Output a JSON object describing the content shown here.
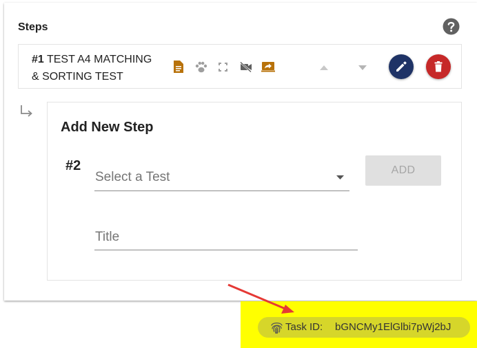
{
  "steps": {
    "heading": "Steps",
    "help_icon": "help-circle-icon",
    "items": [
      {
        "number": "#1",
        "title_line1": "TEST A4 MATCHING",
        "title_line2": "& SORTING TEST",
        "icons": [
          "document-icon",
          "paw-icon",
          "fullscreen-icon",
          "video-off-icon",
          "share-screen-icon"
        ],
        "move_up_icon": "arrow-up-icon",
        "move_down_icon": "arrow-down-icon",
        "edit_icon": "pencil-icon",
        "delete_icon": "trash-icon"
      }
    ]
  },
  "add_step": {
    "title": "Add New Step",
    "next_number": "#2",
    "test_select_label": "Select a Test",
    "title_field_label": "Title",
    "add_button": "ADD"
  },
  "task": {
    "label": "Task ID:",
    "value": "bGNCMy1ElGlbi7pWj2bJ"
  },
  "colors": {
    "orange_icon": "#b8720a",
    "grey_icon": "#9e9e9e",
    "dark_icon": "#5f5f5f",
    "edit_button": "#1f3366",
    "delete_button": "#c62828",
    "highlight": "#ffff00",
    "annotation_arrow": "#e53935"
  }
}
